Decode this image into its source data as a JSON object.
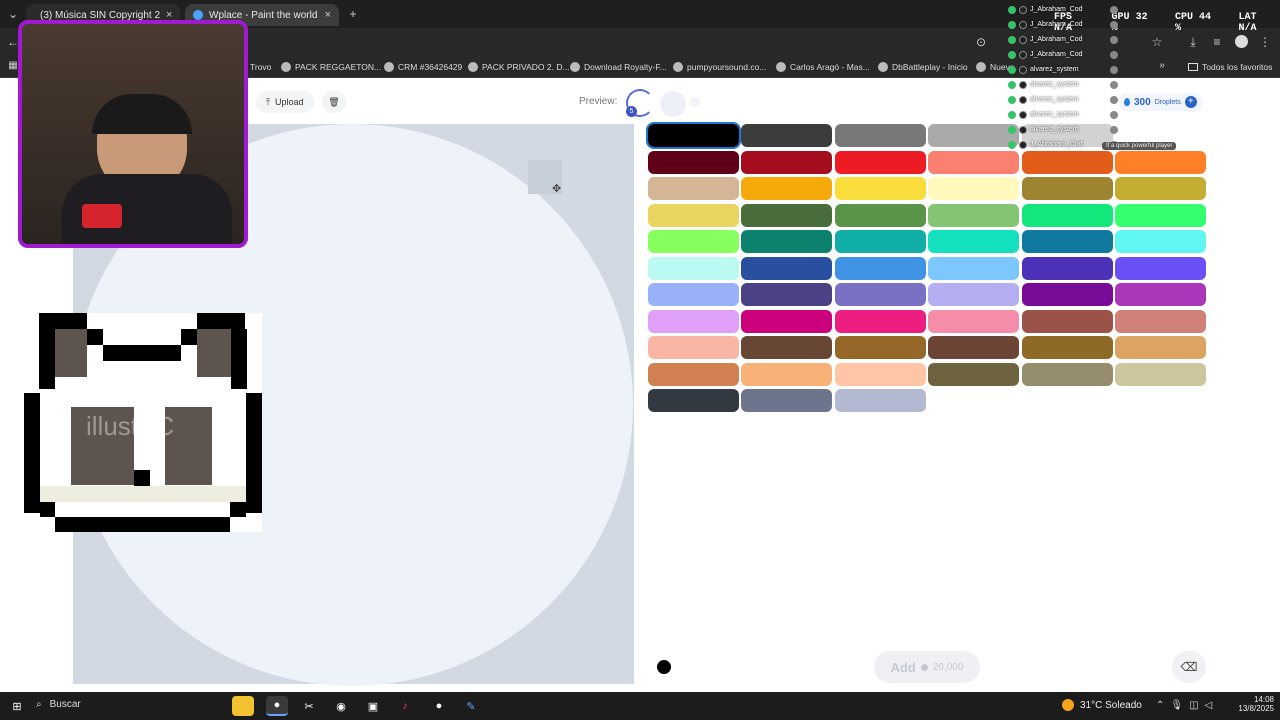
{
  "tabs": [
    {
      "label": "(3) Música SIN Copyright 2",
      "active": false
    },
    {
      "label": "Wplace - Paint the world",
      "active": true
    }
  ],
  "bookmarks": [
    "Trovo",
    "PACK REGGAETON...",
    "CRM #36426429",
    "PACK PRIVADO 2. D...",
    "Download Royalty-F...",
    "pumpyoursound.co...",
    "Carlos Aragó - Mas...",
    "DbBattleplay - Inicio",
    "Nuevo",
    "Todos los favoritos"
  ],
  "stats": {
    "fps_label": "FPS",
    "fps": "N/A",
    "gpu_label": "GPU",
    "gpu": "32 %",
    "cpu_label": "CPU",
    "cpu": "44 %",
    "lat_label": "LAT",
    "lat": "N/A"
  },
  "chat": {
    "users": [
      "J_Abraham_Cod",
      "J_Abraham_Cod",
      "J_Abraham_Cod",
      "J_Abraham_Cod",
      "alvarez_system",
      "alvarez_system",
      "alvarez_system",
      "alvarez_system",
      "alvarez_system",
      "J_Abraham_Cod"
    ],
    "tooltip": "If a quick powerful player"
  },
  "toolbar": {
    "upload_label": "Upload",
    "preview_label": "Preview:",
    "preview_badge": "5"
  },
  "droplets": {
    "count": "300",
    "label": "Droplets"
  },
  "palette": [
    "#000000",
    "#3c3c3c",
    "#787878",
    "#aaaaaa",
    "#d2d2d2",
    "#ffffff",
    "#600018",
    "#a50e1e",
    "#ed1c24",
    "#fa8072",
    "#e45c1a",
    "#ff7f27",
    "#d4b595",
    "#f6aa09",
    "#f9dd3b",
    "#fffabc",
    "#9c8431",
    "#c5ad31",
    "#e8d45f",
    "#4a6b3a",
    "#5a944a",
    "#84c573",
    "#13e67b",
    "#35ff6f",
    "#87ff5e",
    "#0c816e",
    "#10ae a6",
    "#13e1be",
    "#0f799f",
    "#60f7f2",
    "#bbfaf2",
    "#28509e",
    "#4093e4",
    "#7dc7ff",
    "#4d31b8",
    "#6b50f6",
    "#99b1fb",
    "#4a4284",
    "#7a71c4",
    "#b5aef1",
    "#780c99",
    "#aa38b9",
    "#e09ff9",
    "#cb007a",
    "#ec1f80",
    "#f38da9",
    "#9b5249",
    "#d18078",
    "#fab6a4",
    "#684634",
    "#95682a",
    "#6d4537",
    "#8f6a26",
    "#dba463",
    "#d18051",
    "#f8b277",
    "#ffc5a5",
    "#6d643f",
    "#948c6b",
    "#cdc59e",
    "#333941",
    "#6d758d",
    "#b3b9d1"
  ],
  "bottom": {
    "add_label": "Add",
    "add_cost": "20,000"
  },
  "taskbar": {
    "search": "Buscar",
    "weather": "31°C  Soleado",
    "time": "14:08",
    "date": "13/8/2025"
  },
  "panda_watermark": "illustAC"
}
